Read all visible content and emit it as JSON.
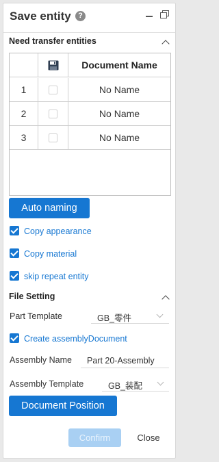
{
  "header": {
    "title": "Save entity",
    "help": "?"
  },
  "transfer": {
    "title": "Need transfer entities",
    "columns": {
      "select_icon": "save-icon",
      "name": "Document Name"
    },
    "rows": [
      {
        "index": "1",
        "name": "No Name"
      },
      {
        "index": "2",
        "name": "No Name"
      },
      {
        "index": "3",
        "name": "No Name"
      }
    ],
    "auto_naming_label": "Auto naming"
  },
  "options": {
    "copy_appearance": "Copy appearance",
    "copy_material": "Copy material",
    "skip_repeat": "skip repeat entity"
  },
  "file_setting": {
    "title": "File Setting",
    "part_template_label": "Part Template",
    "part_template_value": "GB_零件",
    "create_assembly_label": "Create assemblyDocument",
    "assembly_name_label": "Assembly Name",
    "assembly_name_value": "Part 20-Assembly",
    "assembly_template_label": "Assembly Template",
    "assembly_template_value": "GB_装配",
    "document_position_label": "Document Position"
  },
  "footer": {
    "confirm_label": "Confirm",
    "close_label": "Close"
  },
  "colors": {
    "accent": "#1677d2",
    "confirm_disabled": "#a9d0f3"
  }
}
